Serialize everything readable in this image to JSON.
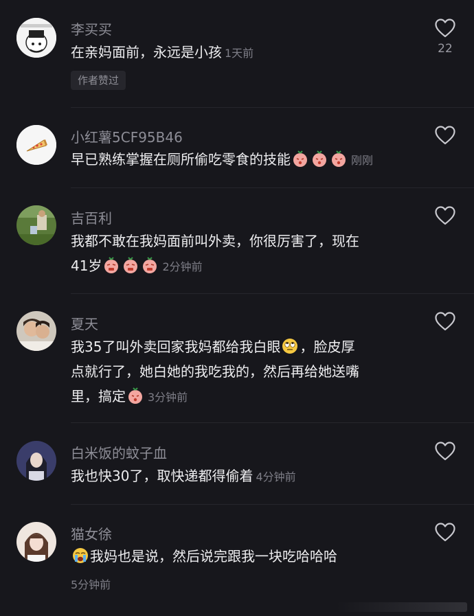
{
  "comments": [
    {
      "username": "李买买",
      "text": "在亲妈面前，永远是小孩",
      "time": "1天前",
      "likes": "22",
      "tag": "作者赞过",
      "avatar_icon": "cartoon-avatar"
    },
    {
      "username": "小红薯5CF95B46",
      "text": "早已熟练掌握在厕所偷吃零食的技能",
      "time": "刚刚",
      "avatar_icon": "pizza-avatar"
    },
    {
      "username": "吉百利",
      "text_line1": "我都不敢在我妈面前叫外卖，你很厉害了，现在",
      "text_line2": "41岁",
      "time": "2分钟前",
      "avatar_icon": "photo-avatar-grass"
    },
    {
      "username": "夏天",
      "text_line1a": "我35了叫外卖回家我妈都给我白眼",
      "text_line1b": "，脸皮厚",
      "text_line2": "点就行了，她白她的我吃我的，然后再给她送嘴",
      "text_line3": "里，搞定",
      "time": "3分钟前",
      "avatar_icon": "photo-avatar-couple"
    },
    {
      "username": "白米饭的蚊子血",
      "text": "我也快30了，取快递都得偷着",
      "time": "4分钟前",
      "avatar_icon": "photo-avatar-girl-dark"
    },
    {
      "username": "猫女徐",
      "text": "我妈也是说，然后说完跟我一块吃哈哈哈",
      "time": "5分钟前",
      "avatar_icon": "photo-avatar-girl-light"
    }
  ],
  "colors": {
    "background": "#17171c",
    "username": "#8d8d96",
    "text": "#eeeef0",
    "meta": "#7e7e87"
  }
}
